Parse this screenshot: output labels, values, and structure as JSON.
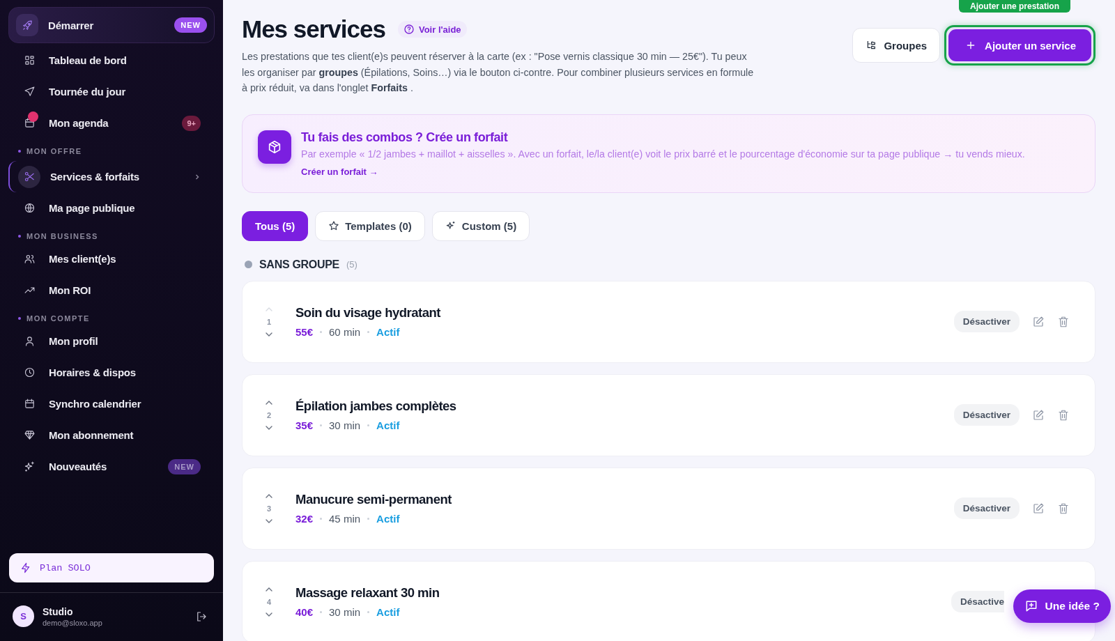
{
  "sidebar": {
    "start": {
      "label": "Démarrer",
      "badge": "NEW"
    },
    "items": [
      {
        "label": "Tableau de bord",
        "selected": false,
        "alert": false
      },
      {
        "label": "Tournée du jour",
        "selected": false,
        "alert": false
      },
      {
        "label": "Mon agenda",
        "selected": false,
        "alert": true,
        "badge": {
          "kind": "count",
          "text": "9+"
        }
      }
    ],
    "sections": [
      {
        "heading": "MON OFFRE",
        "items": [
          {
            "label": "Services & forfaits",
            "selected": true,
            "alert": false
          },
          {
            "label": "Ma page publique",
            "selected": false,
            "alert": false
          }
        ]
      },
      {
        "heading": "MON BUSINESS",
        "items": [
          {
            "label": "Mes client(e)s",
            "selected": false,
            "alert": false
          },
          {
            "label": "Mon ROI",
            "selected": false,
            "alert": false
          }
        ]
      },
      {
        "heading": "MON COMPTE",
        "items": [
          {
            "label": "Mon profil",
            "selected": false,
            "alert": false
          },
          {
            "label": "Horaires & dispos",
            "selected": false,
            "alert": false
          },
          {
            "label": "Synchro calendrier",
            "selected": false,
            "alert": false
          },
          {
            "label": "Mon abonnement",
            "selected": false,
            "alert": false
          },
          {
            "label": "Nouveautés",
            "selected": false,
            "alert": false,
            "badge": {
              "kind": "new",
              "text": "NEW"
            }
          }
        ]
      }
    ],
    "plan": "Plan SOLO",
    "user": {
      "initial": "S",
      "name": "Studio",
      "email": "demo@sloxo.app"
    }
  },
  "header": {
    "title": "Mes services",
    "help": "Voir l'aide",
    "description": "Les prestations que tes client(e)s peuvent réserver à la carte (ex : \"Pose vernis classique 30 min — 25€\"). Tu peux les organiser par **groupes** (Épilations, Soins…) via le bouton ci-contre. Pour combiner plusieurs services en formule à prix réduit, va dans l'onglet **Forfaits** .",
    "groups_button": "Groupes",
    "add_button": "Ajouter un service",
    "tooltip": "Ajouter une prestation"
  },
  "promo": {
    "title": "Tu fais des combos ? Crée un forfait",
    "text": "Par exemple « 1/2 jambes + maillot + aisselles ». Avec un forfait, le/la client(e) voit le prix barré et le pourcentage d'économie sur ta page publique → tu vends mieux.",
    "link": "Créer un forfait →"
  },
  "filters": [
    {
      "label": "Tous (5)",
      "selected": true
    },
    {
      "label": "Templates (0)",
      "selected": false
    },
    {
      "label": "Custom (5)",
      "selected": false
    }
  ],
  "group": {
    "name": "SANS GROUPE",
    "count": "(5)",
    "color": "#9aa3b5"
  },
  "services": [
    {
      "index": "1",
      "name": "Soin du visage hydratant",
      "price": "55€",
      "duration": "60 min",
      "status": "Actif",
      "action": "Désactiver",
      "can_move_up": false
    },
    {
      "index": "2",
      "name": "Épilation jambes complètes",
      "price": "35€",
      "duration": "30 min",
      "status": "Actif",
      "action": "Désactiver",
      "can_move_up": true
    },
    {
      "index": "3",
      "name": "Manucure semi-permanent",
      "price": "32€",
      "duration": "45 min",
      "status": "Actif",
      "action": "Désactiver",
      "can_move_up": true
    },
    {
      "index": "4",
      "name": "Massage relaxant 30 min",
      "price": "40€",
      "duration": "30 min",
      "status": "Actif",
      "action": "Désactive",
      "can_move_up": true
    }
  ],
  "feedback_button": "Une idée ?"
}
